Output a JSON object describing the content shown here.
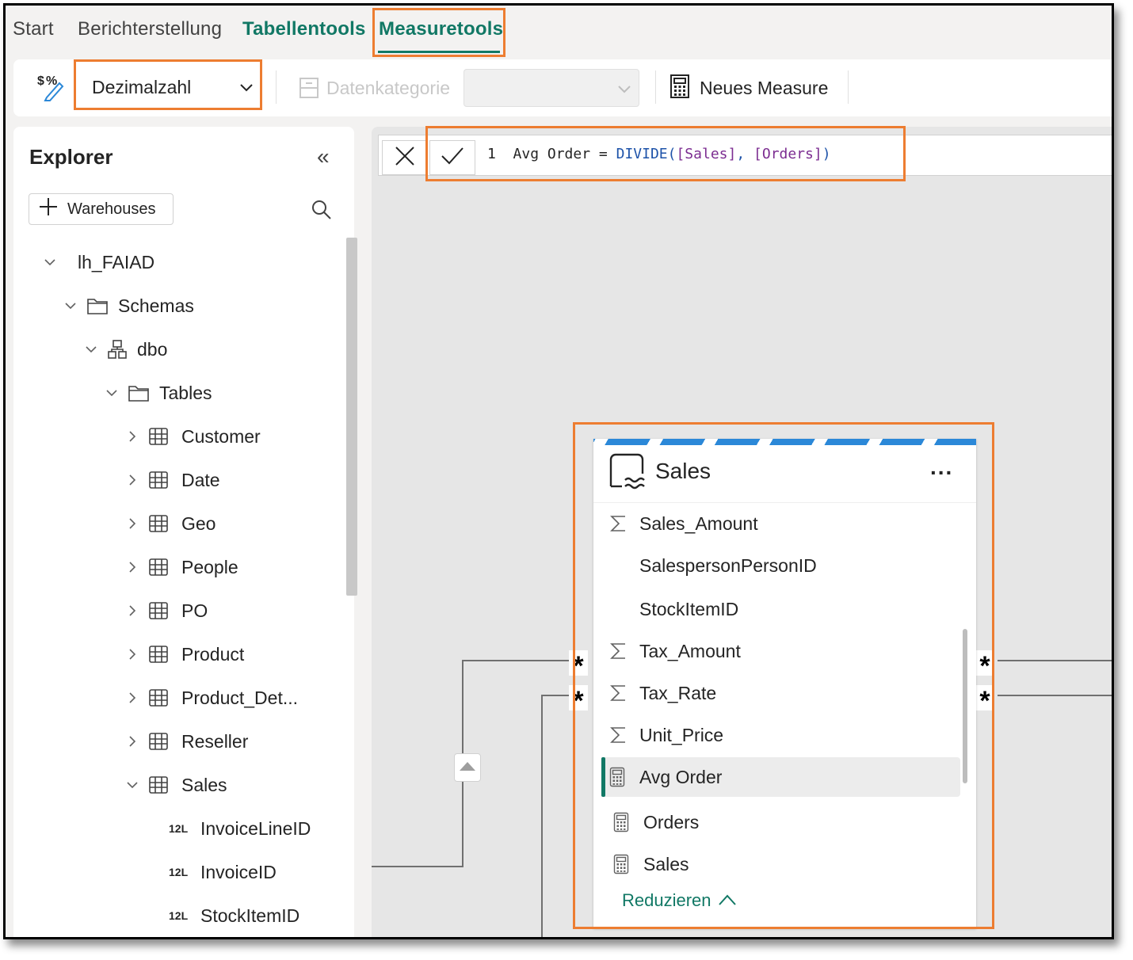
{
  "ribbon": {
    "tabs": [
      {
        "label": "Start"
      },
      {
        "label": "Berichterstellung"
      },
      {
        "label": "Tabellentools"
      },
      {
        "label": "Measuretools"
      }
    ]
  },
  "toolbar": {
    "format_icon": "currency-percent-icon",
    "format_select_value": "Dezimalzahl",
    "data_category_label": "Datenkategorie",
    "data_category_value": "",
    "new_measure_label": "Neues Measure"
  },
  "explorer": {
    "title": "Explorer",
    "collapse_glyph": "«",
    "add_button_label": "Warehouses",
    "tree": [
      {
        "label": "lh_FAIAD",
        "icon": "none",
        "expanded": true
      },
      {
        "label": "Schemas",
        "icon": "folder-icon",
        "expanded": true
      },
      {
        "label": "dbo",
        "icon": "schema-icon",
        "expanded": true
      },
      {
        "label": "Tables",
        "icon": "folder-icon",
        "expanded": true
      },
      {
        "label": "Customer",
        "icon": "table-icon",
        "expanded": false
      },
      {
        "label": "Date",
        "icon": "table-icon",
        "expanded": false
      },
      {
        "label": "Geo",
        "icon": "table-icon",
        "expanded": false
      },
      {
        "label": "People",
        "icon": "table-icon",
        "expanded": false
      },
      {
        "label": "PO",
        "icon": "table-icon",
        "expanded": false
      },
      {
        "label": "Product",
        "icon": "table-icon",
        "expanded": false
      },
      {
        "label": "Product_Det...",
        "icon": "table-icon",
        "expanded": false
      },
      {
        "label": "Reseller",
        "icon": "table-icon",
        "expanded": false
      },
      {
        "label": "Sales",
        "icon": "table-icon",
        "expanded": true
      },
      {
        "label": "InvoiceLineID",
        "icon": "integer-icon"
      },
      {
        "label": "InvoiceID",
        "icon": "integer-icon"
      },
      {
        "label": "StockItemID",
        "icon": "integer-icon"
      }
    ],
    "integer_badge": "12L"
  },
  "formula": {
    "line_number": "1",
    "measure_name": "Avg Order",
    "operator": "=",
    "function": "DIVIDE(",
    "arg1": "[Sales]",
    "separator": ", ",
    "arg2": "[Orders]",
    "closing": ")"
  },
  "table_card": {
    "title": "Sales",
    "more_label": "...",
    "fields": [
      {
        "label": "Sales_Amount",
        "icon": "sigma-icon"
      },
      {
        "label": "SalespersonPersonID",
        "icon": "none"
      },
      {
        "label": "StockItemID",
        "icon": "none"
      },
      {
        "label": "Tax_Amount",
        "icon": "sigma-icon"
      },
      {
        "label": "Tax_Rate",
        "icon": "sigma-icon"
      },
      {
        "label": "Unit_Price",
        "icon": "sigma-icon"
      },
      {
        "label": "Avg Order",
        "icon": "calculator-icon",
        "selected": true
      },
      {
        "label": "Orders",
        "icon": "calculator-icon"
      },
      {
        "label": "Sales",
        "icon": "calculator-icon"
      }
    ],
    "collapse_label": "Reduzieren",
    "relationship_marker": "*"
  },
  "colors": {
    "accent": "#117865",
    "highlight": "#ed7d31",
    "table_stripe": "#2b88d8"
  }
}
